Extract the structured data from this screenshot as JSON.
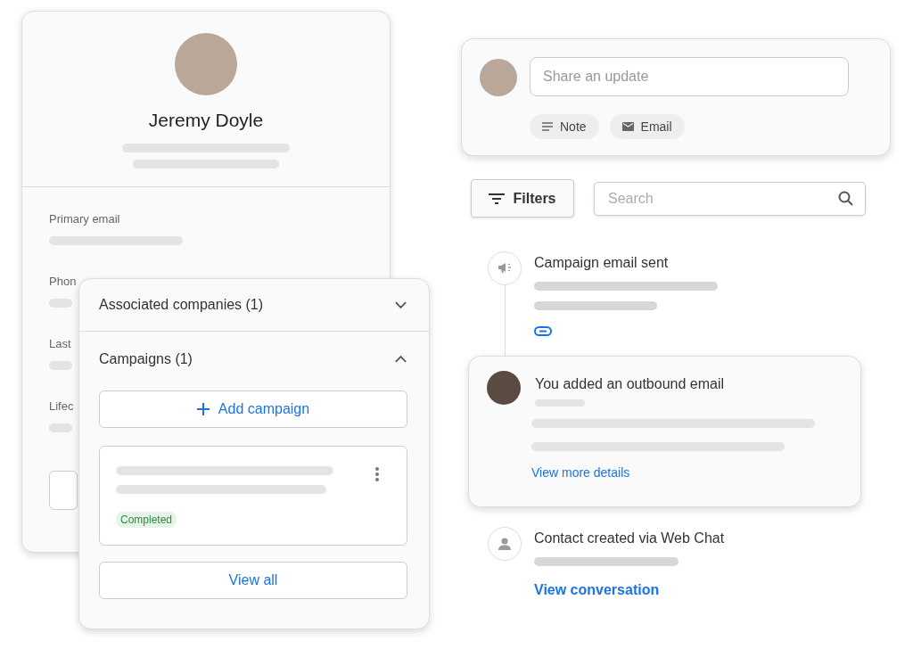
{
  "profile_card": {
    "name": "Jeremy Doyle",
    "fields": [
      {
        "label": "Primary email"
      },
      {
        "label": "Phon"
      },
      {
        "label": "Last"
      },
      {
        "label": "Lifec"
      }
    ]
  },
  "associations_panel": {
    "sections": [
      {
        "title": "Associated companies (1)",
        "expanded": false
      },
      {
        "title": "Campaigns (1)",
        "expanded": true
      }
    ],
    "add_button": "Add campaign",
    "campaign_status": "Completed",
    "view_all": "View all"
  },
  "composer": {
    "placeholder": "Share an update",
    "actions": [
      {
        "kind": "note",
        "label": "Note"
      },
      {
        "kind": "email",
        "label": "Email"
      }
    ]
  },
  "filters_button": "Filters",
  "search": {
    "placeholder": "Search"
  },
  "timeline": [
    {
      "kind": "campaign",
      "title": "Campaign email sent"
    },
    {
      "kind": "email",
      "title": "You added an outbound email",
      "link": "View more details"
    },
    {
      "kind": "contact",
      "title": "Contact created via Web Chat",
      "link": "View conversation"
    }
  ]
}
